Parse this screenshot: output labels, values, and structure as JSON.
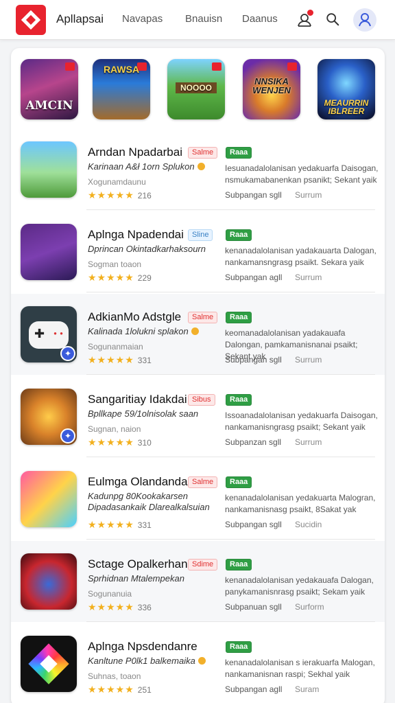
{
  "header": {
    "brand": "Apllapsai",
    "nav": [
      "Navapas",
      "Bnauisn",
      "Daanus"
    ],
    "accent_color": "#e8232e",
    "icons": [
      "logo-icon",
      "bell-icon",
      "search-icon",
      "user-icon"
    ]
  },
  "featured": [
    {
      "label": "AMCIN",
      "has_badge": true
    },
    {
      "label": "RAWSA",
      "has_badge": true
    },
    {
      "label": "NOOOO",
      "has_badge": true
    },
    {
      "label": "NNSIKA WENJEN",
      "has_badge": true
    },
    {
      "label": "MEAURRIN IBLREER",
      "has_badge": false
    }
  ],
  "apps": [
    {
      "title": "Arndan Npadarbai",
      "subtitle": "Karinaan A&ł 1orn Splukon",
      "meta": "Xogunamdaunu",
      "rating": "216",
      "tag": "Salme",
      "tag_style": "sale",
      "tag2": "Raaa",
      "desc": "Iesuanadalolanisan yedakuarfa Daisogan, nsmukamabanenkan psanikt; Sekant yaik",
      "detail_left": "Subpangan sgll",
      "detail_right": "Surrum",
      "has_coin": true
    },
    {
      "title": "Aplnga Npadendai",
      "subtitle": "Dprincan Okintadkarhaksourn",
      "meta": "Sogman toaon",
      "rating": "229",
      "tag": "Sline",
      "tag_style": "blue",
      "tag2": "Raaa",
      "desc": "kenanadalolanisan yadakauarta Dalogan, nankamansngrasg psaikt. Sekara yaik",
      "detail_left": "Subpangan agll",
      "detail_right": "Surrum",
      "has_coin": false
    },
    {
      "title": "AdkianMo Adstgle",
      "subtitle": "Kalinada 1lolukni splakon",
      "meta": "Sogunanmaian",
      "rating": "331",
      "tag": "Salme",
      "tag_style": "sale",
      "tag2": "Raaa",
      "desc": "keomanadalolanisan yadakauafa Dalongan, pamkamanisnanai psaikt; Sekant yak",
      "detail_left": "Subpangan sgll",
      "detail_right": "Surrum",
      "has_coin": true
    },
    {
      "title": "Sangaritiay Idakdai",
      "subtitle": "Bpllkape 59/1olnisolak saan",
      "meta": "Sugnan, naion",
      "rating": "310",
      "tag": "Sibus",
      "tag_style": "sale",
      "tag2": "Raaa",
      "desc": "Issoanadalolanisan yedakuarfa Daisogan, nankamanisngrasg psaikt; Sekant yaik",
      "detail_left": "Subpanzan sgll",
      "detail_right": "Surrum",
      "has_coin": false
    },
    {
      "title": "Eulmga Olandandai",
      "subtitle": "Kadunpg 80Kookakarsen",
      "subtitle2": "Dipadasankaik Dlarealkalsuian",
      "meta": "",
      "rating": "331",
      "tag": "Salme",
      "tag_style": "sale",
      "tag2": "Raaa",
      "desc": "kenanadalolanisan yedakuarta Malogran, nankamanisnasg psaikt, 8Sakat yak",
      "detail_left": "Subpangan sgll",
      "detail_right": "Sucidin",
      "has_coin": false
    },
    {
      "title": "Sctage Opalkerhan",
      "subtitle": "Sprhidnan Mtalempekan",
      "meta": "Sogunanuia",
      "rating": "336",
      "tag": "Sdime",
      "tag_style": "sale",
      "tag2": "Raaa",
      "desc": "kenanadalolanisan yedakauafa Dalogan, panykamanisnrasg psaikt; Sekam yaik",
      "detail_left": "Subpanuan sgll",
      "detail_right": "Surform",
      "has_coin": false
    },
    {
      "title": "Aplnga Npsdendanre",
      "subtitle": "Kanltune P0lk1 balkemaika",
      "meta": "Suhnas, toaon",
      "rating": "251",
      "tag": "",
      "tag_style": "none",
      "tag2": "Raaa",
      "desc": "kenanadalolanisan s ierakuarfa Malogan, nankamanisnan raspi; Sekhal yaik",
      "detail_left": "Subpangan agll",
      "detail_right": "Suram",
      "has_coin": true
    }
  ]
}
